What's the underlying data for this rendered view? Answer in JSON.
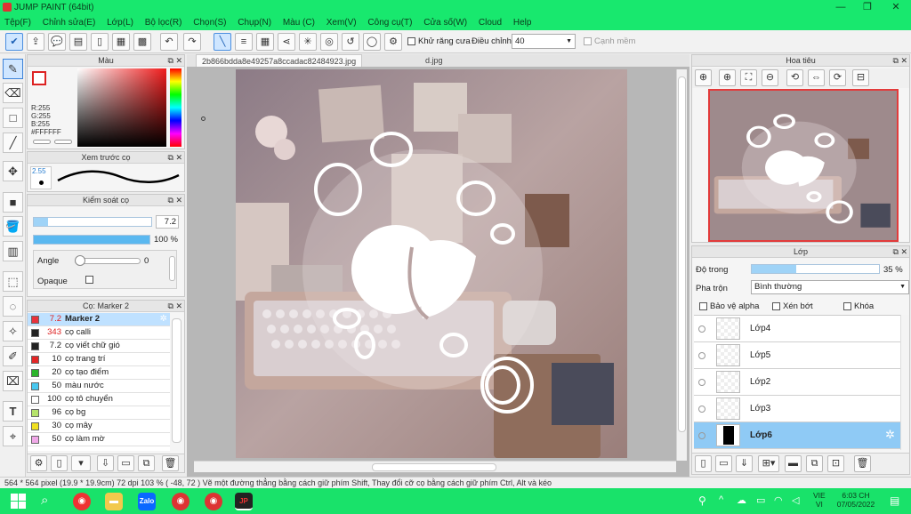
{
  "window": {
    "title": "JUMP PAINT (64bit)",
    "controls": [
      "—",
      "❐",
      "✕"
    ]
  },
  "menu": [
    "Tệp(F)",
    "Chỉnh sửa(E)",
    "Lớp(L)",
    "Bộ lọc(R)",
    "Chọn(S)",
    "Chụp(N)",
    "Màu (C)",
    "Xem(V)",
    "Công cụ(T)",
    "Cửa số(W)",
    "Cloud",
    "Help"
  ],
  "toolbar": {
    "antialias_label": "Khử răng cưa",
    "adjust_label": "Điều chỉnh",
    "adjust_value": "40",
    "edge_label": "Cạnh mềm"
  },
  "color_panel": {
    "title": "Màu",
    "r": "R:255",
    "g": "G:255",
    "b": "B:255",
    "hex": "#FFFFFF"
  },
  "brush_preview": {
    "title": "Xem trước cọ",
    "size": "2.55"
  },
  "brush_control": {
    "title": "Kiểm soát cọ",
    "size_value": "7.2",
    "opacity_value": "100 %",
    "opacity_fraction": 1.0,
    "angle_label": "Angle",
    "angle_value": "0",
    "opaque_label": "Opaque"
  },
  "brush_list": {
    "title": "Cọ: Marker 2",
    "items": [
      {
        "size": "7.2",
        "name": "Marker 2",
        "color": "#e8323c"
      },
      {
        "size": "343",
        "name": "cọ calli",
        "color": "#222222"
      },
      {
        "size": "7.2",
        "name": "cọ viết chữ gió",
        "color": "#222222"
      },
      {
        "size": "10",
        "name": "cọ trang trí",
        "color": "#e32626"
      },
      {
        "size": "20",
        "name": "cọ tạo điểm",
        "color": "#2bb52b"
      },
      {
        "size": "50",
        "name": "màu nước",
        "color": "#48c8f0"
      },
      {
        "size": "100",
        "name": "cọ tô chuyển",
        "color": "#ffffff"
      },
      {
        "size": "96",
        "name": "cọ bg",
        "color": "#b5e36a"
      },
      {
        "size": "30",
        "name": "cọ mây",
        "color": "#f0e020"
      },
      {
        "size": "50",
        "name": "cọ làm mờ",
        "color": "#f0a8e8"
      }
    ]
  },
  "tabs": [
    {
      "label": "2b866bdda8e49257a8ccadac82484923.jpg",
      "active": true
    },
    {
      "label": "d.jpg",
      "active": false
    }
  ],
  "navigator": {
    "title": "Hoa tiêu"
  },
  "layers": {
    "title": "Lớp",
    "opacity_label": "Độ trong",
    "opacity_value": "35 %",
    "opacity_fraction": 0.35,
    "blend_label": "Pha trộn",
    "blend_value": "Bình thường",
    "protect_alpha": "Bảo vệ alpha",
    "clip": "Xén bớt",
    "lock": "Khóa",
    "items": [
      {
        "name": "Lớp4",
        "selected": false
      },
      {
        "name": "Lớp5",
        "selected": false
      },
      {
        "name": "Lớp2",
        "selected": false
      },
      {
        "name": "Lớp3",
        "selected": false
      },
      {
        "name": "Lớp6",
        "selected": true
      }
    ]
  },
  "status": {
    "text": "564 * 564 pixel   (19.9 * 19.9cm)   72 dpi   103 %   ( -48, 72 )   Vẽ một đường thẳng bằng cách giữ phím Shift, Thay đổi cỡ cọ bằng cách giữ phím Ctrl, Alt và kéo"
  },
  "taskbar": {
    "lang1": "VIE",
    "lang2": "VI",
    "time": "6:03 CH",
    "date": "07/05/2022"
  }
}
